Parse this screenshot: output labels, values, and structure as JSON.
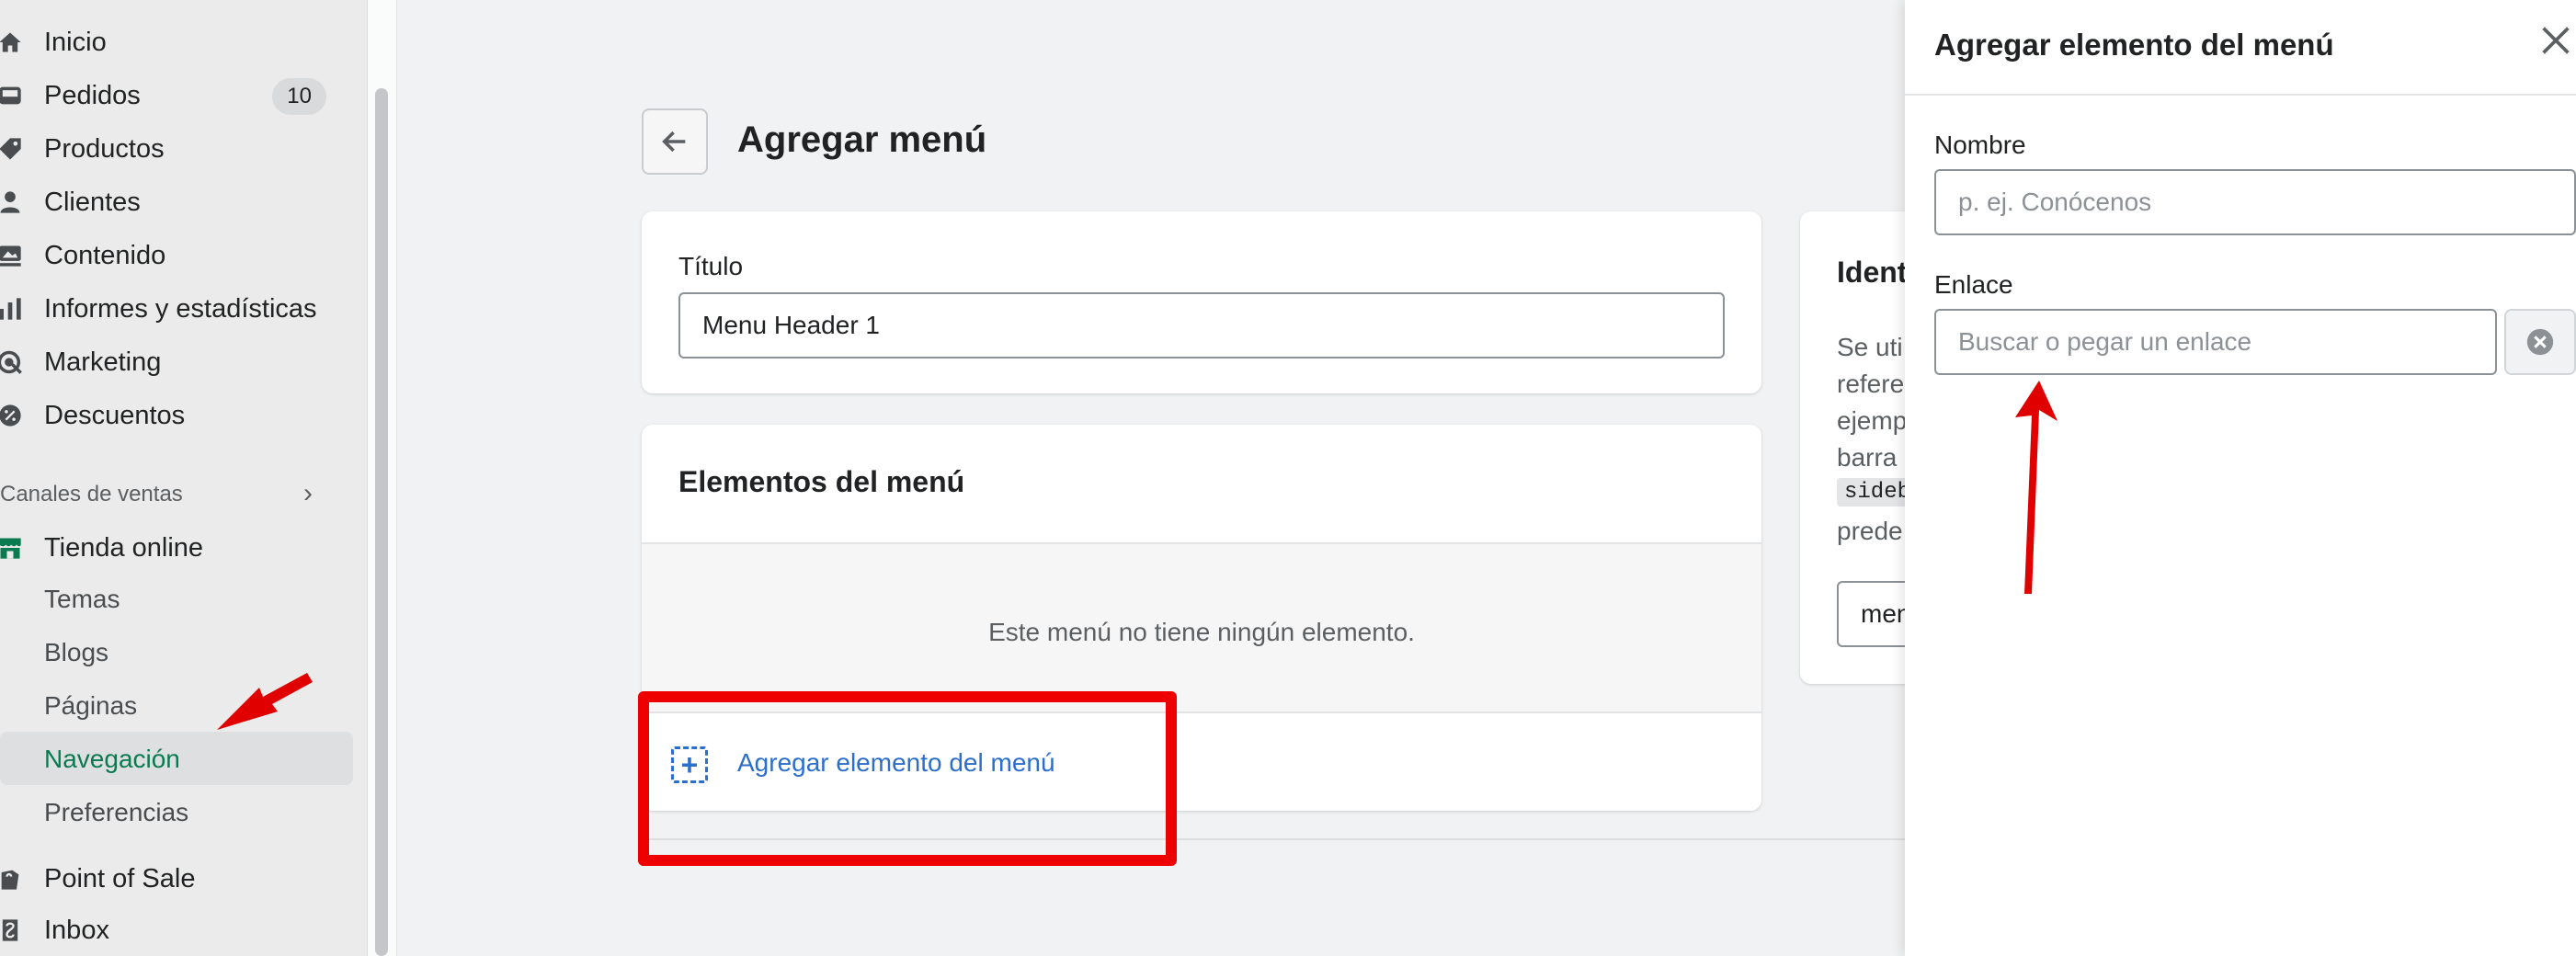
{
  "sidebar": {
    "items": [
      {
        "label": "Inicio",
        "icon": "home-icon"
      },
      {
        "label": "Pedidos",
        "icon": "orders-icon",
        "badge": "10"
      },
      {
        "label": "Productos",
        "icon": "tag-icon"
      },
      {
        "label": "Clientes",
        "icon": "person-icon"
      },
      {
        "label": "Contenido",
        "icon": "content-icon"
      },
      {
        "label": "Informes y estadísticas",
        "icon": "bar-chart-icon"
      },
      {
        "label": "Marketing",
        "icon": "marketing-icon"
      },
      {
        "label": "Descuentos",
        "icon": "discount-icon"
      }
    ],
    "section_label": "Canales de ventas",
    "channel": {
      "label": "Tienda online",
      "icon": "store-icon"
    },
    "sub_items": [
      "Temas",
      "Blogs",
      "Páginas",
      "Navegación",
      "Preferencias"
    ],
    "active_sub_item": "Navegación",
    "apps": [
      {
        "label": "Point of Sale",
        "icon": "pos-icon"
      },
      {
        "label": "Inbox",
        "icon": "inbox-icon"
      }
    ]
  },
  "main": {
    "page_title": "Agregar menú",
    "title_card": {
      "label": "Título",
      "value": "Menu Header 1"
    },
    "items_card": {
      "heading": "Elementos del menú",
      "empty_text": "Este menú no tiene ningún elemento.",
      "add_link": "Agregar elemento del menú"
    },
    "handle_card": {
      "title_partial": "Ident",
      "lines_partial": [
        "Se uti",
        "refere",
        "ejemp",
        "barra",
        "prede"
      ],
      "code_partial": "sideb",
      "input_partial": "men"
    }
  },
  "drawer": {
    "title": "Agregar elemento del menú",
    "name_label": "Nombre",
    "name_placeholder": "p. ej. Conócenos",
    "link_label": "Enlace",
    "link_placeholder": "Buscar o pegar un enlace"
  },
  "colors": {
    "accent_green": "#0a7a50",
    "link_blue": "#2c6ecb",
    "annotation_red": "#ee0000"
  }
}
